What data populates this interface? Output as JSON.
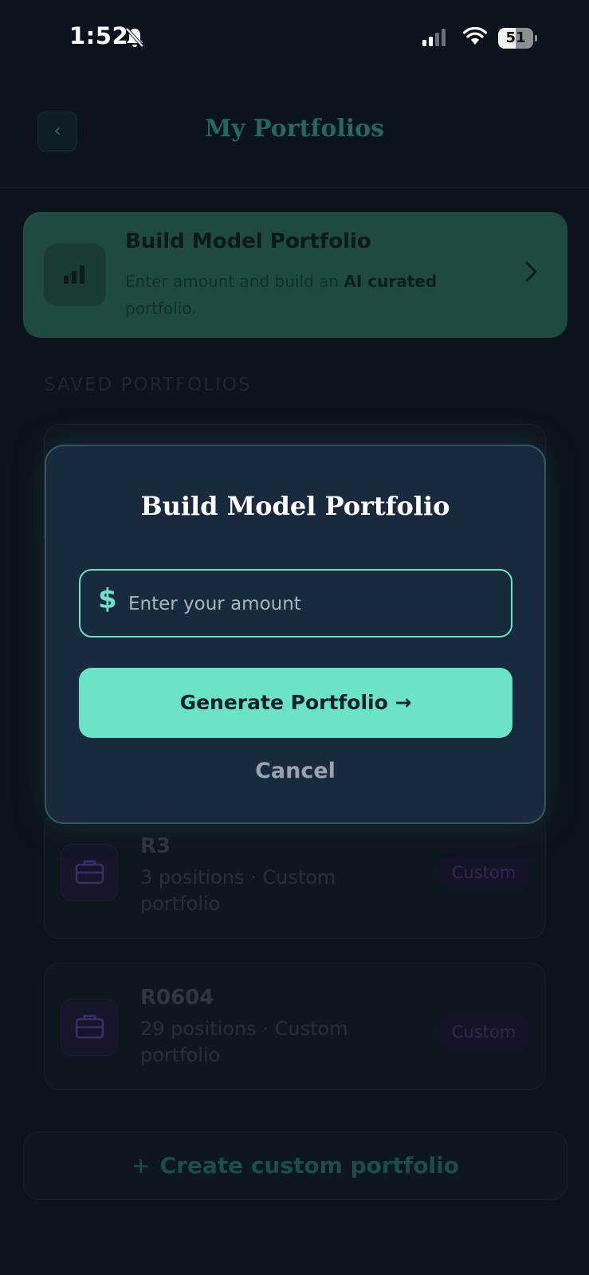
{
  "status": {
    "time": "1:52",
    "battery": "51"
  },
  "header": {
    "back_icon": "chevron-left",
    "title": "My Portfolios"
  },
  "build_card": {
    "title": "Build Model Portfolio",
    "desc_prefix": "Enter amount and build an ",
    "desc_bold": "AI curated",
    "desc_suffix": " portfolio.",
    "icon": "bar-chart-icon"
  },
  "section": {
    "label": "SAVED PORTFOLIOS"
  },
  "saved": [
    {
      "name": "R3",
      "meta": "3 positions · Custom portfolio",
      "badge": "Custom"
    },
    {
      "name": "R0604",
      "meta": "29 positions · Custom portfolio",
      "badge": "Custom"
    }
  ],
  "create": {
    "plus": "+",
    "label": "Create custom portfolio"
  },
  "modal": {
    "title": "Build Model Portfolio",
    "currency": "$",
    "placeholder": "Enter your amount",
    "generate_label": "Generate Portfolio →",
    "cancel_label": "Cancel"
  },
  "colors": {
    "accent": "#6ae3c9",
    "background": "#0c131c",
    "modal": "#1a2a3e"
  }
}
